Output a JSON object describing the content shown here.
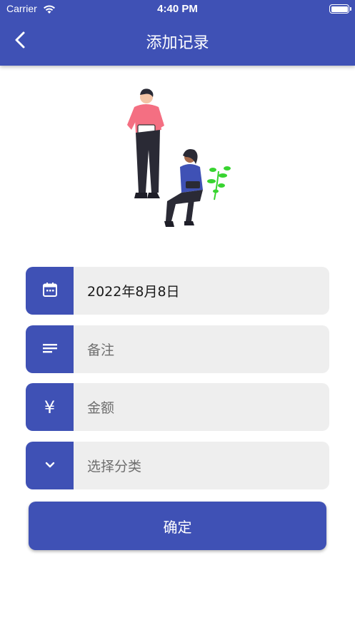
{
  "status_bar": {
    "carrier": "Carrier",
    "time": "4:40 PM"
  },
  "header": {
    "title": "添加记录",
    "back_icon": "chevron-left-icon"
  },
  "form": {
    "date": {
      "icon": "calendar-icon",
      "value": "2022年8月8日"
    },
    "note": {
      "icon": "notes-icon",
      "placeholder": "备注"
    },
    "amount": {
      "icon": "yen-icon",
      "icon_glyph": "¥",
      "placeholder": "金额"
    },
    "category": {
      "icon": "chevron-down-icon",
      "placeholder": "选择分类"
    }
  },
  "confirm_label": "确定",
  "colors": {
    "primary": "#3f51b5",
    "field_bg": "#eeeeee",
    "plant": "#38d430",
    "shirt_pink": "#f46f82"
  }
}
